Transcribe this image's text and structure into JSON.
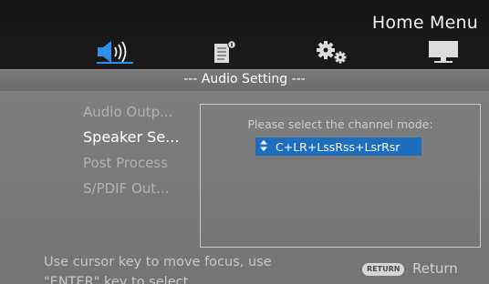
{
  "header": {
    "title": "Home Menu"
  },
  "tabs": [
    {
      "name": "audio",
      "icon": "speaker-icon",
      "selected": true
    },
    {
      "name": "document",
      "icon": "document-icon",
      "selected": false
    },
    {
      "name": "settings",
      "icon": "gear-icon",
      "selected": false
    },
    {
      "name": "display",
      "icon": "monitor-icon",
      "selected": false
    }
  ],
  "section": {
    "title": "--- Audio Setting ---"
  },
  "menu": {
    "items": [
      {
        "label": "Audio Outp..."
      },
      {
        "label": "Speaker Se..."
      },
      {
        "label": "Post Process"
      },
      {
        "label": "S/PDIF Out..."
      }
    ],
    "active_index": 1
  },
  "channel_select": {
    "prompt": "Please select the channel mode:",
    "selected_option": "C+LR+LssRss+LsrRsr"
  },
  "footer": {
    "help_text": "Use cursor key to move focus, use \"ENTER\" key to select",
    "return_badge": "RETURN",
    "return_label": "Return"
  },
  "colors": {
    "selection": "#1e6ec0",
    "accent_icon": "#2e8fe6",
    "background": "#7d7d7d",
    "header_bg": "#151515"
  }
}
